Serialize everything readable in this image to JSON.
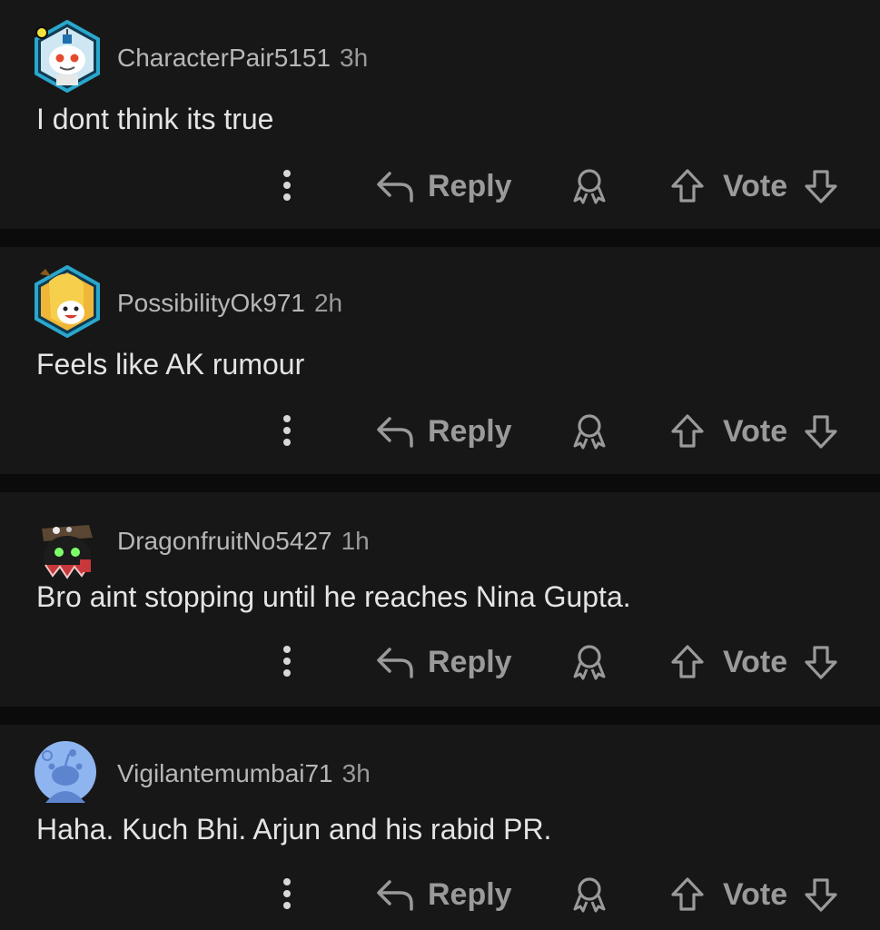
{
  "comments": [
    {
      "username": "CharacterPair5151",
      "time": "3h",
      "body": "I dont think its true",
      "avatar_icon": "robot-snoo-avatar-icon"
    },
    {
      "username": "PossibilityOk971",
      "time": "2h",
      "body": "Feels like AK rumour",
      "avatar_icon": "banana-snoo-avatar-icon"
    },
    {
      "username": "DragonfruitNo5427",
      "time": "1h",
      "body": "Bro aint stopping until he reaches Nina Gupta.",
      "avatar_icon": "hooded-snoo-avatar-icon"
    },
    {
      "username": "Vigilantemumbai71",
      "time": "3h",
      "body": "Haha. Kuch Bhi. Arjun and his rabid PR.",
      "avatar_icon": "default-snoo-avatar-icon"
    }
  ],
  "actions": {
    "reply_label": "Reply",
    "vote_label": "Vote",
    "more_icon": "vertical-ellipsis-icon",
    "reply_icon": "reply-arrow-icon",
    "award_icon": "award-icon",
    "upvote_icon": "upvote-arrow-icon",
    "downvote_icon": "downvote-arrow-icon"
  },
  "colors": {
    "page_background": "#0b0b0b",
    "card_background": "#171717",
    "body_text": "#e4e4e4",
    "muted_text": "#9a9a9a",
    "icon_gray": "#9a9a9a"
  }
}
